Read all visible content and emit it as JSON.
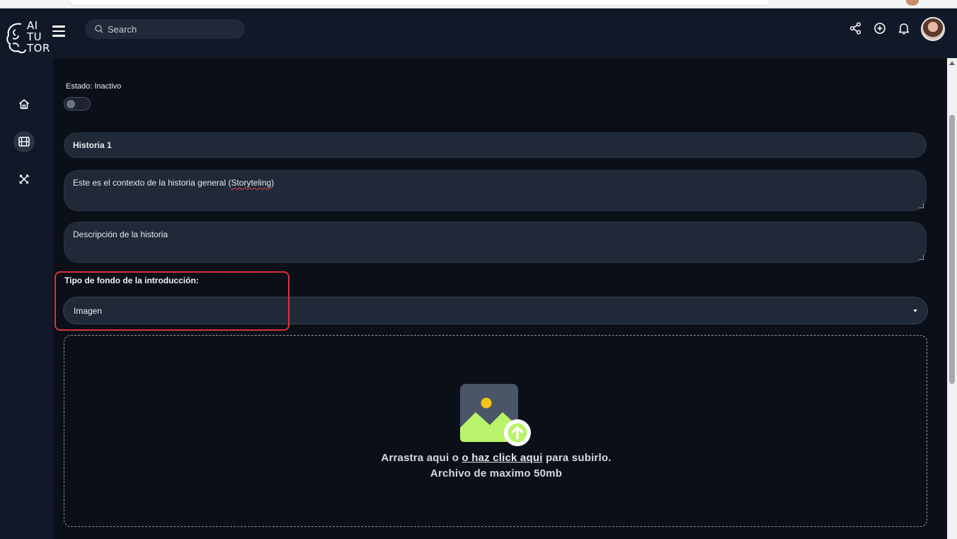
{
  "header": {
    "logo_lines": [
      "AI",
      "TU",
      "TOR"
    ],
    "search_placeholder": "Search",
    "icons": [
      "share-icon",
      "add-circle-icon",
      "bell-icon"
    ]
  },
  "sidebar": {
    "items": [
      {
        "name": "home",
        "icon": "home-icon",
        "active": false
      },
      {
        "name": "stories",
        "icon": "film-icon",
        "active": true
      },
      {
        "name": "tools",
        "icon": "tools-icon",
        "active": false
      }
    ]
  },
  "form": {
    "status_label": "Estado: Inactivo",
    "status_on": false,
    "title_value": "Historia 1",
    "context_value_prefix": "Este es el contexto de la historia general (",
    "context_value_misspelled": "Storyteling",
    "context_value_suffix": ")",
    "description_placeholder": "Descripción de la historia",
    "background_type_label": "Tipo de fondo de la introducción:",
    "background_type_value": "Imagen"
  },
  "dropzone": {
    "line1_prefix": "Arrastra aqui o ",
    "line1_link": "o haz click aqui",
    "line1_suffix": " para subirlo.",
    "line2": "Archivo de maximo 50mb"
  },
  "colors": {
    "background": "#0b0f17",
    "panel": "#111827",
    "field": "#1f2937",
    "highlight": "#e0313a",
    "image_green": "#b9f36b",
    "sun": "#f5c518"
  }
}
